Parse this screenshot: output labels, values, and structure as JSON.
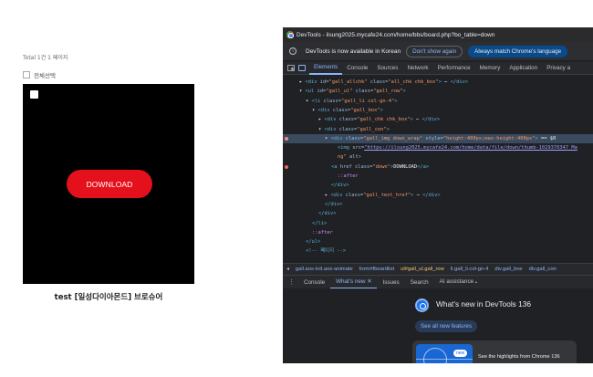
{
  "page": {
    "total_text": "Total 1건 1 페이지",
    "select_all_label": "전체선택",
    "download_label": "DOWNLOAD",
    "product_title": "test [일성다이아몬드] 브로슈어"
  },
  "devtools": {
    "title": "DevTools - ilsung2025.mycafe24.com/home/bbs/board.php?bo_table=down",
    "info": {
      "icon": "info-icon",
      "text": "DevTools is now available in Korean",
      "dont_show_label": "Don't show again",
      "match_label": "Always match Chrome's language"
    },
    "tabs": [
      "Elements",
      "Console",
      "Sources",
      "Network",
      "Performance",
      "Memory",
      "Application",
      "Privacy a"
    ],
    "active_tab": "Elements",
    "dom_lines": [
      {
        "indent": 18,
        "parts": [
          [
            "plain",
            "▸ "
          ],
          [
            "tag",
            "<div "
          ],
          [
            "attr",
            "id="
          ],
          [
            "val",
            "\"gall_allchk\""
          ],
          [
            "attr",
            " class="
          ],
          [
            "val",
            "\"all_chk chk_box\""
          ],
          [
            "tag",
            ">"
          ],
          [
            "plain",
            " ⋯ "
          ],
          [
            "tag",
            "</div>"
          ]
        ]
      },
      {
        "indent": 18,
        "parts": [
          [
            "plain",
            "▾ "
          ],
          [
            "tag",
            "<ul "
          ],
          [
            "attr",
            "id="
          ],
          [
            "val",
            "\"gall_ul\""
          ],
          [
            "attr",
            " class="
          ],
          [
            "val",
            "\"gall_row\""
          ],
          [
            "tag",
            ">"
          ]
        ]
      },
      {
        "indent": 25,
        "parts": [
          [
            "plain",
            "▾ "
          ],
          [
            "tag",
            "<li "
          ],
          [
            "attr",
            "class="
          ],
          [
            "val",
            "\"gall_li col-gn-4\""
          ],
          [
            "tag",
            ">"
          ]
        ]
      },
      {
        "indent": 32,
        "parts": [
          [
            "plain",
            "▾ "
          ],
          [
            "tag",
            "<div "
          ],
          [
            "attr",
            "class="
          ],
          [
            "val",
            "\"gall_box\""
          ],
          [
            "tag",
            ">"
          ]
        ]
      },
      {
        "indent": 39,
        "parts": [
          [
            "plain",
            "▸ "
          ],
          [
            "tag",
            "<div "
          ],
          [
            "attr",
            "class="
          ],
          [
            "val",
            "\"gall_chk chk_box\""
          ],
          [
            "tag",
            ">"
          ],
          [
            "plain",
            " ⋯ "
          ],
          [
            "tag",
            "</div>"
          ]
        ]
      },
      {
        "indent": 39,
        "parts": [
          [
            "plain",
            "▾ "
          ],
          [
            "tag",
            "<div "
          ],
          [
            "attr",
            "class="
          ],
          [
            "val",
            "\"gall_con\""
          ],
          [
            "tag",
            ">"
          ]
        ]
      },
      {
        "indent": 46,
        "hl": true,
        "dot": "bp",
        "parts": [
          [
            "plain",
            "▾ "
          ],
          [
            "tag",
            "<div "
          ],
          [
            "attr",
            "class="
          ],
          [
            "val",
            "\"gall_img down_wrap\""
          ],
          [
            "attr",
            " style="
          ],
          [
            "val",
            "\"height:400px;max-height:400px\""
          ],
          [
            "tag",
            ">"
          ],
          [
            "plain",
            " == $0"
          ]
        ]
      },
      {
        "indent": 60,
        "parts": [
          [
            "tag",
            "<img "
          ],
          [
            "attr",
            "src="
          ],
          [
            "link",
            "\"https://ilsung2025.mycafe24.com/home/data/file/down/thumb-1029370347_Ma"
          ]
        ]
      },
      {
        "indent": 60,
        "parts": [
          [
            "val",
            "ng\""
          ],
          [
            "attr",
            " alt"
          ],
          [
            "tag",
            ">"
          ]
        ]
      },
      {
        "indent": 53,
        "dot": "sel",
        "parts": [
          [
            "tag",
            "<a "
          ],
          [
            "attr",
            "href"
          ],
          [
            "attr",
            " class="
          ],
          [
            "val",
            "\"down\""
          ],
          [
            "tag",
            ">"
          ],
          [
            "plain",
            "DOWNLOAD"
          ],
          [
            "tag",
            "</a>"
          ]
        ]
      },
      {
        "indent": 60,
        "parts": [
          [
            "pseudo",
            "::after"
          ]
        ]
      },
      {
        "indent": 53,
        "parts": [
          [
            "tag",
            "</div>"
          ]
        ]
      },
      {
        "indent": 46,
        "parts": [
          [
            "plain",
            "▸ "
          ],
          [
            "tag",
            "<div "
          ],
          [
            "attr",
            "class="
          ],
          [
            "val",
            "\"gall_text_href\""
          ],
          [
            "tag",
            ">"
          ],
          [
            "plain",
            " ⋯ "
          ],
          [
            "tag",
            "</div>"
          ]
        ]
      },
      {
        "indent": 46,
        "parts": [
          [
            "tag",
            "</div>"
          ]
        ]
      },
      {
        "indent": 39,
        "parts": [
          [
            "tag",
            "</div>"
          ]
        ]
      },
      {
        "indent": 32,
        "parts": [
          [
            "tag",
            "</li>"
          ]
        ]
      },
      {
        "indent": 32,
        "parts": [
          [
            "pseudo",
            "::after"
          ]
        ]
      },
      {
        "indent": 25,
        "parts": [
          [
            "tag",
            "</ul>"
          ]
        ]
      },
      {
        "indent": 25,
        "parts": [
          [
            "tag",
            "<!-- 페이지 -->"
          ]
        ]
      }
    ],
    "breadcrumbs": [
      "◂",
      "gall.aos-init.aos-animate",
      "form#fboardlist",
      "ul#gall_ul.gall_row",
      "li.gall_li.col-gn-4",
      "div.gall_box",
      "div.gall_con"
    ],
    "breadcrumb_highlight_index": 3,
    "drawer": {
      "menu_icon": "kebab-menu-icon",
      "tabs": [
        "Console",
        "What's new ✕",
        "Issues",
        "Search",
        "AI assistance 𝅘"
      ],
      "active_tab": "What's new ✕"
    },
    "whats_new": {
      "title": "What's new in DevTools 136",
      "see_all": "See all new features",
      "badge": "new",
      "card_text": "See the highlights from Chrome 136"
    }
  }
}
